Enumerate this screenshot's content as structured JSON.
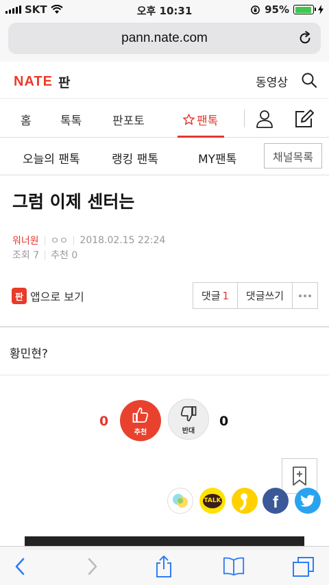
{
  "status_bar": {
    "carrier": "SKT",
    "time": "오후 10:31",
    "battery": "95%",
    "battery_level": 0.95
  },
  "browser": {
    "url": "pann.nate.com"
  },
  "header": {
    "brand": "NATE",
    "service": "판",
    "video_link": "동영상"
  },
  "main_tabs": [
    {
      "label": "홈"
    },
    {
      "label": "톡톡"
    },
    {
      "label": "판포토"
    },
    {
      "label": "팬톡"
    }
  ],
  "sub_tabs": {
    "today": "오늘의 팬톡",
    "ranking": "랭킹 팬톡",
    "my": "MY팬톡",
    "channel_list": "채널목록"
  },
  "article": {
    "title": "그럼 이제 센터는",
    "author": "워너원",
    "author_id": "ㅇㅇ",
    "date": "2018.02.15 22:24",
    "views": "조회 7",
    "recommends": "추천 0",
    "app_view": "앱으로 보기",
    "app_icon": "판",
    "comments_label": "댓글",
    "comments_count": "1",
    "write_comment": "댓글쓰기",
    "body": "황민현?"
  },
  "votes": {
    "up_count": "0",
    "up_label": "추천",
    "down_label": "반대",
    "down_count": "0"
  },
  "share": {
    "kakao_label": "TALK",
    "facebook_label": "f"
  },
  "colors": {
    "accent": "#e4372d",
    "kakao": "#ffe200",
    "facebook": "#3b5999",
    "twitter": "#2aa3ef"
  }
}
